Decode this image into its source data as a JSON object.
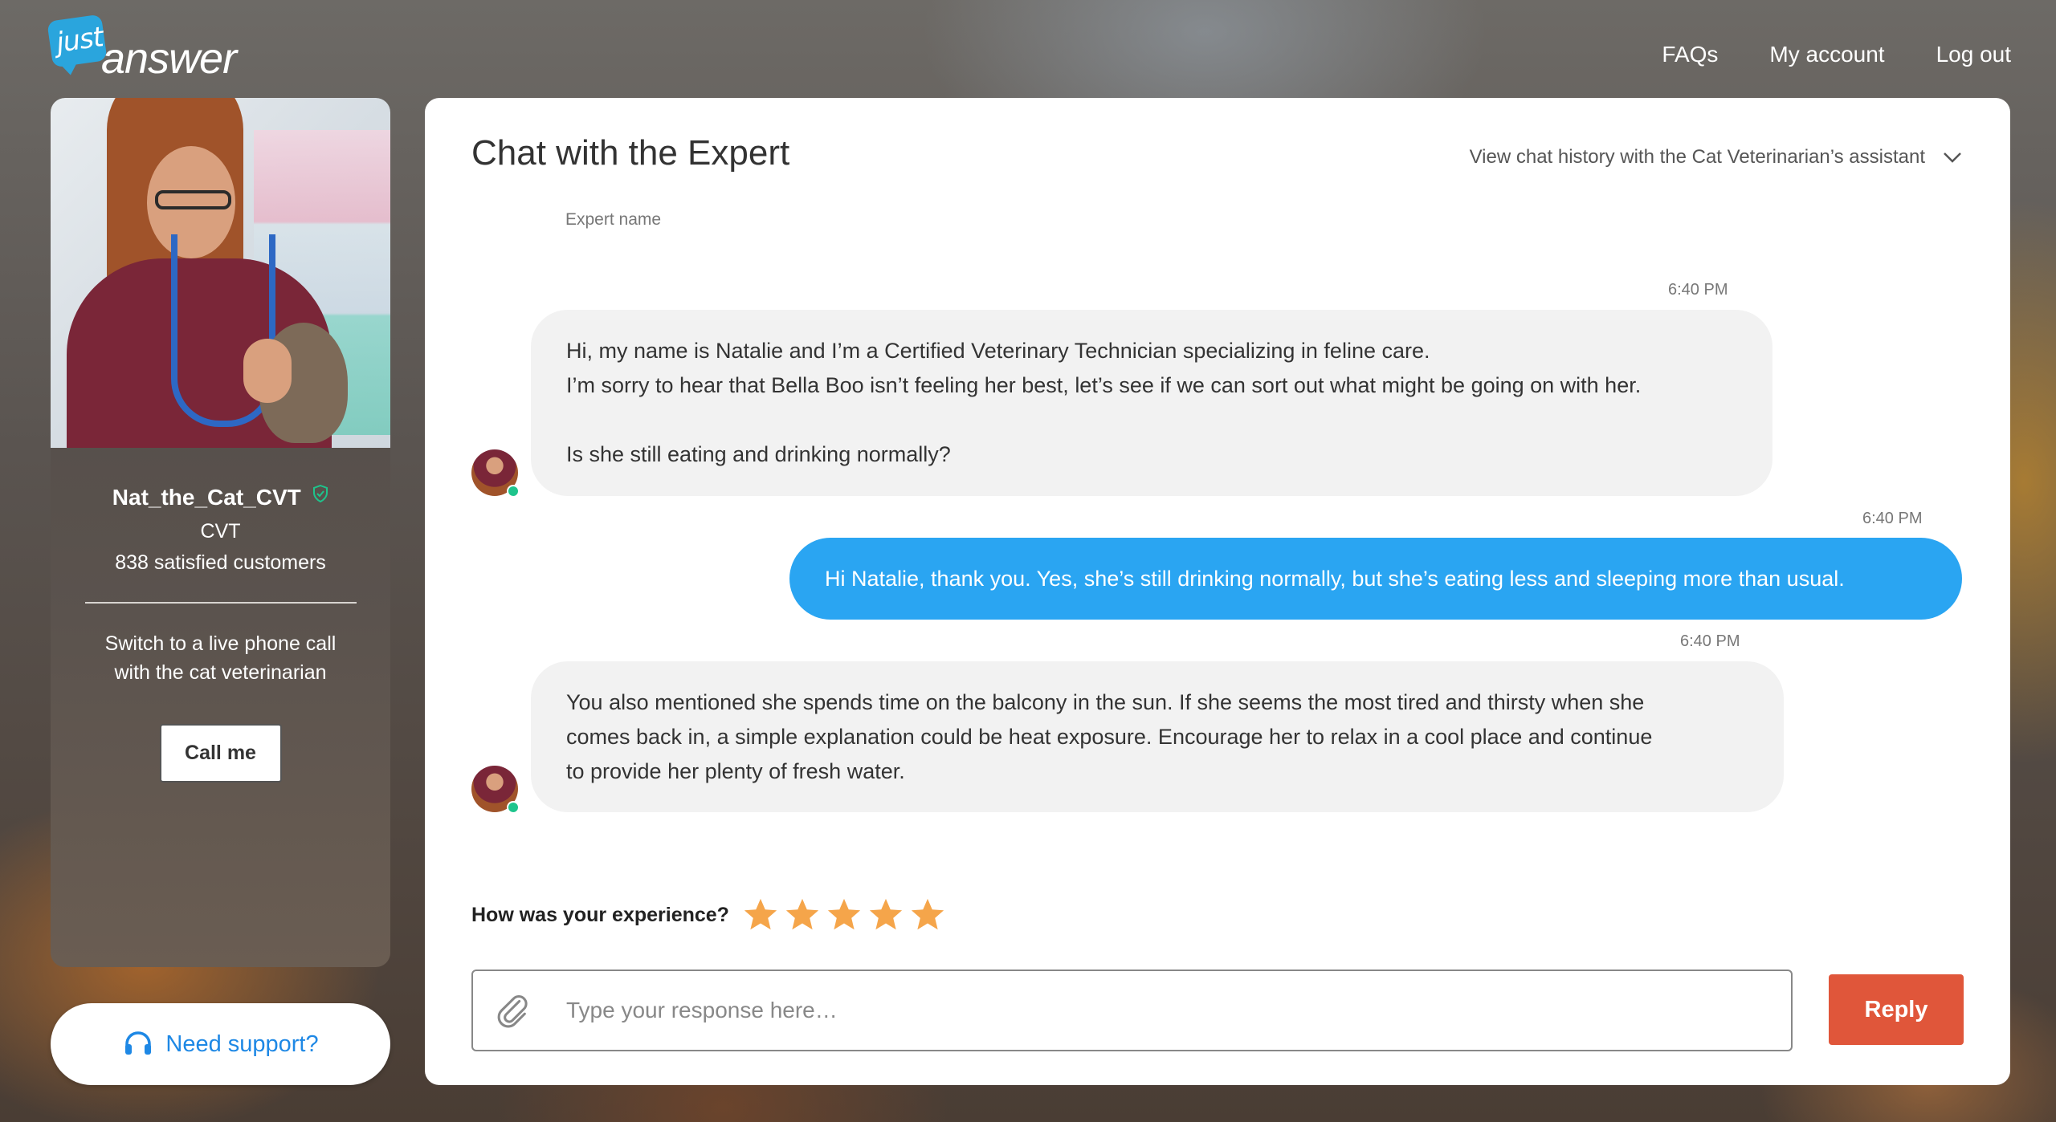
{
  "header": {
    "logo_top": "just",
    "logo_main": "answer",
    "nav": {
      "faqs": "FAQs",
      "account": "My account",
      "logout": "Log out"
    }
  },
  "expert": {
    "name": "Nat_the_Cat_CVT",
    "title": "CVT",
    "customers": "838 satisfied customers",
    "phone_text_1": "Switch to a live phone call",
    "phone_text_2": "with the cat veterinarian",
    "call_label": "Call me"
  },
  "support": {
    "label": "Need support?"
  },
  "chat": {
    "title": "Chat with the Expert",
    "history_label": "View chat history with the Cat Veterinarian’s assistant",
    "expert_name_label": "Expert name",
    "messages": [
      {
        "time": "6:40 PM",
        "sender": "expert",
        "lines": [
          "Hi, my name is Natalie and I’m a Certified Veterinary Technician specializing in feline care.",
          "I’m sorry to hear that Bella Boo isn’t feeling her best, let’s see if we can sort out what might be going on with her.",
          "",
          "Is she still eating and drinking normally?"
        ]
      },
      {
        "time": "6:40 PM",
        "sender": "user",
        "lines": [
          "Hi Natalie, thank you. Yes, she’s still drinking normally, but she’s eating less and sleeping more than usual."
        ]
      },
      {
        "time": "6:40 PM",
        "sender": "expert",
        "lines": [
          "You also mentioned she spends time on the balcony in the sun. If she seems the most tired and thirsty when she",
          "comes back in, a simple explanation could be heat exposure. Encourage her to relax in a cool place and continue",
          "to provide her plenty of fresh water."
        ]
      }
    ]
  },
  "rating": {
    "label": "How was your experience?",
    "stars": 5
  },
  "composer": {
    "placeholder": "Type your response here…",
    "reply_label": "Reply"
  },
  "colors": {
    "brand_blue": "#2aa5dd",
    "user_bubble": "#2aa5f2",
    "reply_button": "#e0563a",
    "star": "#f5a54a",
    "online": "#1ec48c"
  }
}
